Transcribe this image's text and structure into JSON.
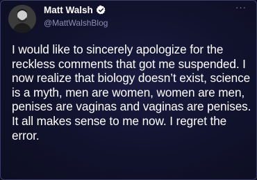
{
  "author": {
    "display_name": "Matt Walsh",
    "handle": "@MattWalshBlog",
    "verified": true,
    "avatar_icon": "profile-photo"
  },
  "tweet": {
    "text": "I would like to sincerely apologize for the reckless comments that got me suspended. I now realize that biology doesn’t exist, science is a myth, men are women, women are men, penises are vaginas and vaginas are penises. It all makes sense to me now. I regret the error."
  },
  "menu": {
    "more_label": "···",
    "icon": "more-options-icon"
  },
  "colors": {
    "background": "#0f1026",
    "text": "#ffffff",
    "handle": "#8b8fb5",
    "verified_badge": "#1d9bf0"
  }
}
